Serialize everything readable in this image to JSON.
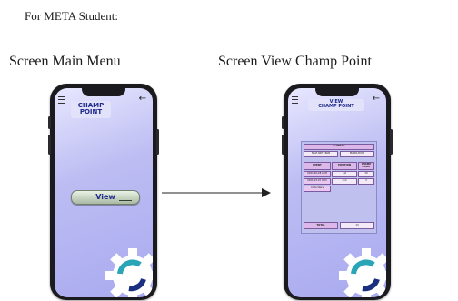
{
  "heading": "For META Student:",
  "captions": {
    "main_menu": "Screen Main Menu",
    "view_champ_point": "Screen View Champ Point"
  },
  "main_menu_screen": {
    "title_line1": "CHAMP",
    "title_line2": "POINT",
    "view_button_label": "View",
    "icons": [
      "menu-icon",
      "back-arrow-icon",
      "gear-icon"
    ]
  },
  "view_screen": {
    "title_line1": "VIEW",
    "title_line2": "CHAMP POINT",
    "student_label": "STUDENT",
    "student_name": "NAM ANH TRAN",
    "student_id": "M2001/0070",
    "columns": [
      "EVENT",
      "POSITION",
      "CHAMP POINT"
    ],
    "rows": [
      [
        "2021-02-28 ACM",
        "1st",
        "10"
      ],
      [
        "2021-03-07 ICPC",
        "2nd",
        "3"
      ],
      [
        "Code Wars",
        "",
        ""
      ]
    ],
    "total_label": "TOTAL",
    "total_value": "13",
    "icons": [
      "menu-icon",
      "back-arrow-icon",
      "gear-icon"
    ]
  },
  "colors": {
    "screen_gradient_top": "#e7e7ff",
    "screen_gradient_bottom": "#a9aaf0",
    "title_text": "#1f2a8a",
    "table_cell": "#e8c7f0",
    "gear_teal": "#2aa5b8"
  }
}
